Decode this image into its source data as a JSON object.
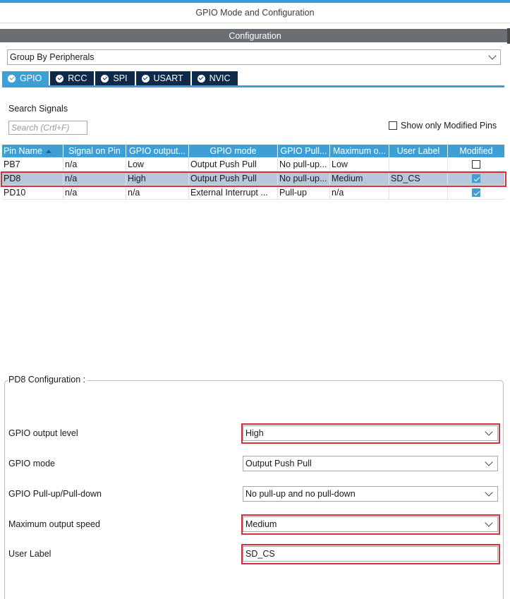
{
  "window": {
    "title": "GPIO Mode and Configuration",
    "section_header": "Configuration"
  },
  "group_select": {
    "value": "Group By Peripherals"
  },
  "tabs": [
    {
      "label": "GPIO",
      "active": true
    },
    {
      "label": "RCC",
      "active": false
    },
    {
      "label": "SPI",
      "active": false
    },
    {
      "label": "USART",
      "active": false
    },
    {
      "label": "NVIC",
      "active": false
    }
  ],
  "search": {
    "label": "Search Signals",
    "placeholder": "Search (Crtl+F)",
    "modified_only_label": "Show only Modified Pins",
    "modified_only_checked": false
  },
  "table": {
    "columns": [
      "Pin Name",
      "Signal on Pin",
      "GPIO output...",
      "GPIO mode",
      "GPIO Pull...",
      "Maximum o...",
      "User Label",
      "Modified"
    ],
    "rows": [
      {
        "cells": [
          "PB7",
          "n/a",
          "Low",
          "Output Push Pull",
          "No pull-up...",
          "Low",
          ""
        ],
        "modified": false,
        "selected": false
      },
      {
        "cells": [
          "PD8",
          "n/a",
          "High",
          "Output Push Pull",
          "No pull-up...",
          "Medium",
          "SD_CS"
        ],
        "modified": true,
        "selected": true
      },
      {
        "cells": [
          "PD10",
          "n/a",
          "n/a",
          "External Interrupt ...",
          "Pull-up",
          "n/a",
          ""
        ],
        "modified": true,
        "selected": false
      }
    ]
  },
  "pin_config": {
    "title": "PD8 Configuration :",
    "fields": [
      {
        "label": "GPIO output level",
        "value": "High",
        "type": "select",
        "highlighted": true
      },
      {
        "label": "GPIO mode",
        "value": "Output Push Pull",
        "type": "select",
        "highlighted": false
      },
      {
        "label": "GPIO Pull-up/Pull-down",
        "value": "No pull-up and no pull-down",
        "type": "select",
        "highlighted": false
      },
      {
        "label": "Maximum output speed",
        "value": "Medium",
        "type": "select",
        "highlighted": true
      },
      {
        "label": "User Label",
        "value": "SD_CS",
        "type": "text",
        "highlighted": true
      }
    ]
  },
  "colors": {
    "accent": "#3d9fd6",
    "tab_inactive": "#0d2a4a",
    "header_bar": "#6a6f74",
    "selected_row": "#b8c8dc",
    "highlight_border": "#d8303c"
  }
}
